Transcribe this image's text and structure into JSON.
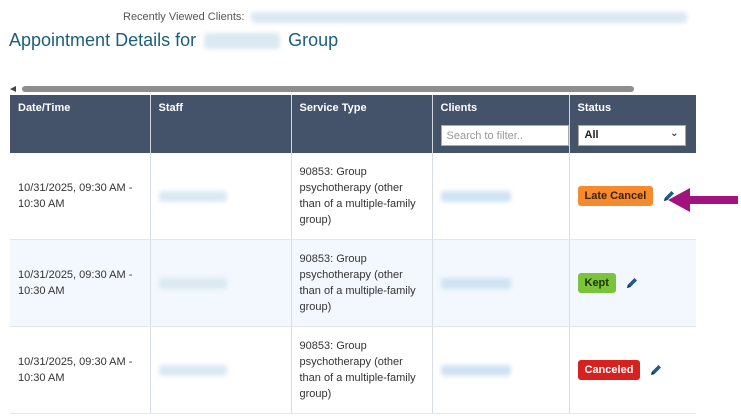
{
  "recent": {
    "label": "Recently Viewed Clients:"
  },
  "title": {
    "prefix": "Appointment Details for",
    "suffix": "Group"
  },
  "table": {
    "columns": [
      "Date/Time",
      "Staff",
      "Service Type",
      "Clients",
      "Status"
    ],
    "client_filter_placeholder": "Search to filter..",
    "status_filter_value": "All",
    "rows": [
      {
        "datetime": "10/31/2025, 09:30 AM - 10:30 AM",
        "service": "90853: Group psychotherapy (other than of a multiple-family group)",
        "status": "Late Cancel"
      },
      {
        "datetime": "10/31/2025, 09:30 AM - 10:30 AM",
        "service": "90853: Group psychotherapy (other than of a multiple-family group)",
        "status": "Kept"
      },
      {
        "datetime": "10/31/2025, 09:30 AM - 10:30 AM",
        "service": "90853: Group psychotherapy (other than of a multiple-family group)",
        "status": "Canceled"
      }
    ]
  },
  "colors": {
    "header_bg": "#44526a",
    "title_text": "#1c5f7c",
    "late_cancel": "#f58b2e",
    "kept": "#7cc33c",
    "canceled": "#d7211e",
    "arrow": "#a3137f",
    "edit_icon": "#1d5c86"
  },
  "icons": {
    "edit": "pencil-icon",
    "pointer": "arrow-left-icon"
  }
}
